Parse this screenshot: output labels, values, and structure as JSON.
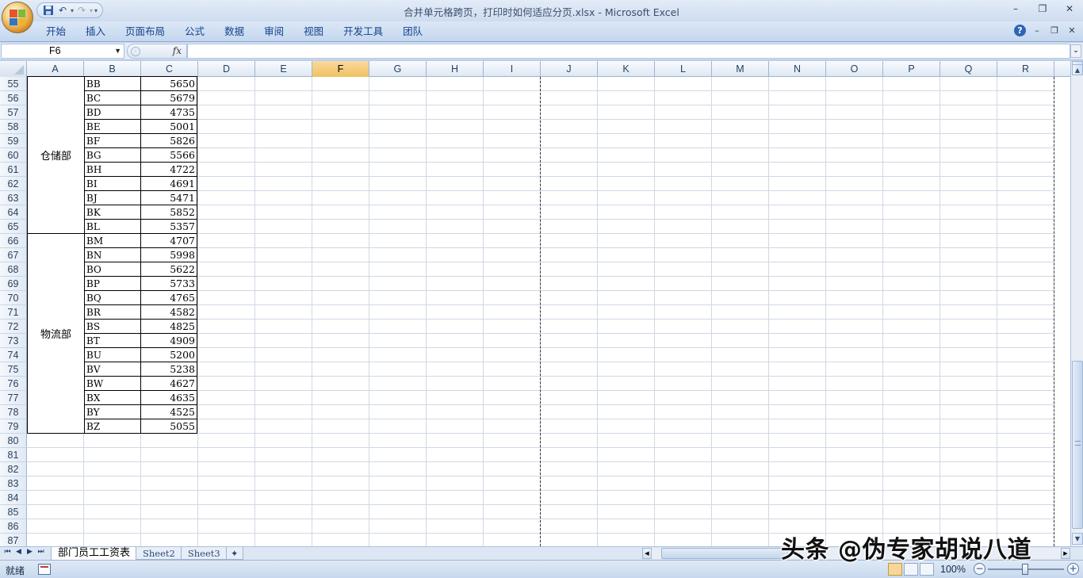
{
  "window": {
    "title": "合并单元格跨页，打印时如何适应分页.xlsx - Microsoft Excel",
    "controls": [
      "–",
      "❐",
      "✕"
    ]
  },
  "qat": {
    "save": "save-icon",
    "undo": "undo-icon",
    "redo": "redo-icon"
  },
  "ribbon": {
    "tabs": [
      "开始",
      "插入",
      "页面布局",
      "公式",
      "数据",
      "审阅",
      "视图",
      "开发工具",
      "团队"
    ]
  },
  "formula_bar": {
    "name_box": "F6",
    "fx": "fx",
    "formula": ""
  },
  "grid": {
    "columns": [
      "A",
      "B",
      "C",
      "D",
      "E",
      "F",
      "G",
      "H",
      "I",
      "J",
      "K",
      "L",
      "M",
      "N",
      "O",
      "P",
      "Q",
      "R"
    ],
    "active_column": "F",
    "rows": [
      "55",
      "56",
      "57",
      "58",
      "59",
      "60",
      "61",
      "62",
      "63",
      "64",
      "65",
      "66",
      "67",
      "68",
      "69",
      "70",
      "71",
      "72",
      "73",
      "74",
      "75",
      "76",
      "77",
      "78",
      "79",
      "80",
      "81",
      "82",
      "83",
      "84",
      "85",
      "86",
      "87"
    ],
    "groups": [
      {
        "label": "仓储部",
        "rows": 11
      },
      {
        "label": "物流部",
        "rows": 14
      }
    ],
    "data": [
      [
        "BB",
        "5650"
      ],
      [
        "BC",
        "5679"
      ],
      [
        "BD",
        "4735"
      ],
      [
        "BE",
        "5001"
      ],
      [
        "BF",
        "5826"
      ],
      [
        "BG",
        "5566"
      ],
      [
        "BH",
        "4722"
      ],
      [
        "BI",
        "4691"
      ],
      [
        "BJ",
        "5471"
      ],
      [
        "BK",
        "5852"
      ],
      [
        "BL",
        "5357"
      ],
      [
        "BM",
        "4707"
      ],
      [
        "BN",
        "5998"
      ],
      [
        "BO",
        "5622"
      ],
      [
        "BP",
        "5733"
      ],
      [
        "BQ",
        "4765"
      ],
      [
        "BR",
        "4582"
      ],
      [
        "BS",
        "4825"
      ],
      [
        "BT",
        "4909"
      ],
      [
        "BU",
        "5200"
      ],
      [
        "BV",
        "5238"
      ],
      [
        "BW",
        "4627"
      ],
      [
        "BX",
        "4635"
      ],
      [
        "BY",
        "4525"
      ],
      [
        "BZ",
        "5055"
      ]
    ]
  },
  "sheets": {
    "tabs": [
      "部门员工工资表",
      "Sheet2",
      "Sheet3"
    ],
    "active": "部门员工工资表"
  },
  "status": {
    "ready": "就绪",
    "zoom": "100%"
  },
  "watermark": "头条 @伪专家胡说八道"
}
